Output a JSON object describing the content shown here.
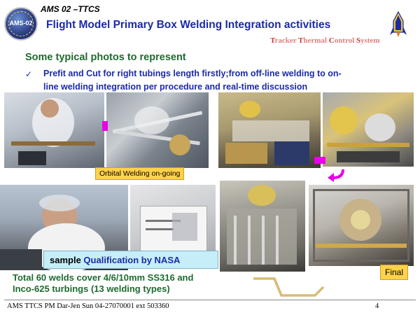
{
  "header": {
    "logo_text": "AMS-02",
    "project_label": "AMS 02  –TTCS",
    "title": "Flight Model Primary Box Welding Integration activities",
    "subtitle_parts": [
      {
        "cap": "T",
        "rest": "racker "
      },
      {
        "cap": "T",
        "rest": "hermal "
      },
      {
        "cap": "C",
        "rest": "ontrol "
      },
      {
        "cap": "S",
        "rest": "ystem"
      }
    ],
    "rocket_icon": "rocket-logo-icon"
  },
  "content": {
    "heading": "Some typical photos to represent",
    "bullet_mark": "✓",
    "bullet_line1": "Prefit and Cut for right tubings length firstly;from off-line welding to on-",
    "bullet_line2": "line welding integration per procedure and real-time discussion"
  },
  "labels": {
    "orbital": "Orbital Welding on-going",
    "sample_prefix": "sample ",
    "sample_highlight": "Qualification by NASA",
    "final": "Final"
  },
  "summary": {
    "line1": "Total 60 welds cover 4/6/10mm SS316 and",
    "line2": "Inco-625 turbings (13 welding types)"
  },
  "footer": {
    "text": "AMS TTCS PM  Dar-Jen Sun 04-27070001 ext 503360",
    "page_number": "4"
  },
  "colors": {
    "title_blue": "#1b2aa8",
    "heading_green": "#1d6b2e",
    "arrow_magenta": "#e800e8",
    "label_yellow": "#ffd24a",
    "sample_cyan": "#c6eef8"
  }
}
